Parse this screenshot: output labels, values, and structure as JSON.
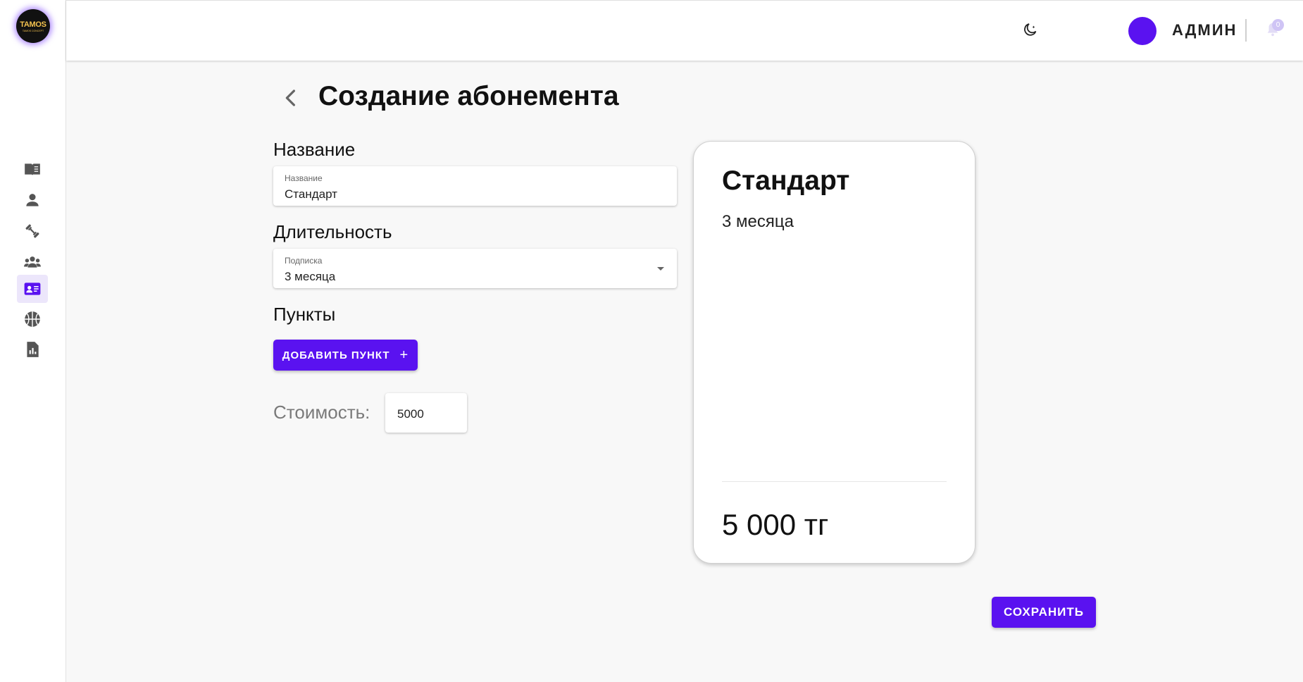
{
  "brand": {
    "logo_text": "TAMOS",
    "logo_subtext": "TAMOS CONCEPT"
  },
  "sidebar": {
    "items": [
      {
        "icon": "book-icon",
        "active": false
      },
      {
        "icon": "person-icon",
        "active": false
      },
      {
        "icon": "dumbbell-icon",
        "active": false
      },
      {
        "icon": "group-icon",
        "active": false
      },
      {
        "icon": "id-card-icon",
        "active": true
      },
      {
        "icon": "ball-icon",
        "active": false
      },
      {
        "icon": "report-icon",
        "active": false
      }
    ]
  },
  "header": {
    "username": "АДМИН",
    "notifications_count": "0",
    "theme_icon": "moon-icon",
    "accent_color": "#5a12f0"
  },
  "page": {
    "title": "Создание абонемента"
  },
  "form": {
    "name_section": "Название",
    "name_field": {
      "label": "Название",
      "value": "Стандарт"
    },
    "duration_section": "Длительность",
    "duration_field": {
      "label": "Подписка",
      "value": "3 месяца"
    },
    "points_section": "Пункты",
    "add_point_label": "ДОБАВИТЬ ПУНКТ",
    "add_point_icon": "+",
    "price_label": "Стоимость:",
    "price_value": "5000",
    "save_label": "СОХРАНИТЬ"
  },
  "preview": {
    "name": "Стандарт",
    "duration": "3 месяца",
    "price": "5 000 тг"
  }
}
